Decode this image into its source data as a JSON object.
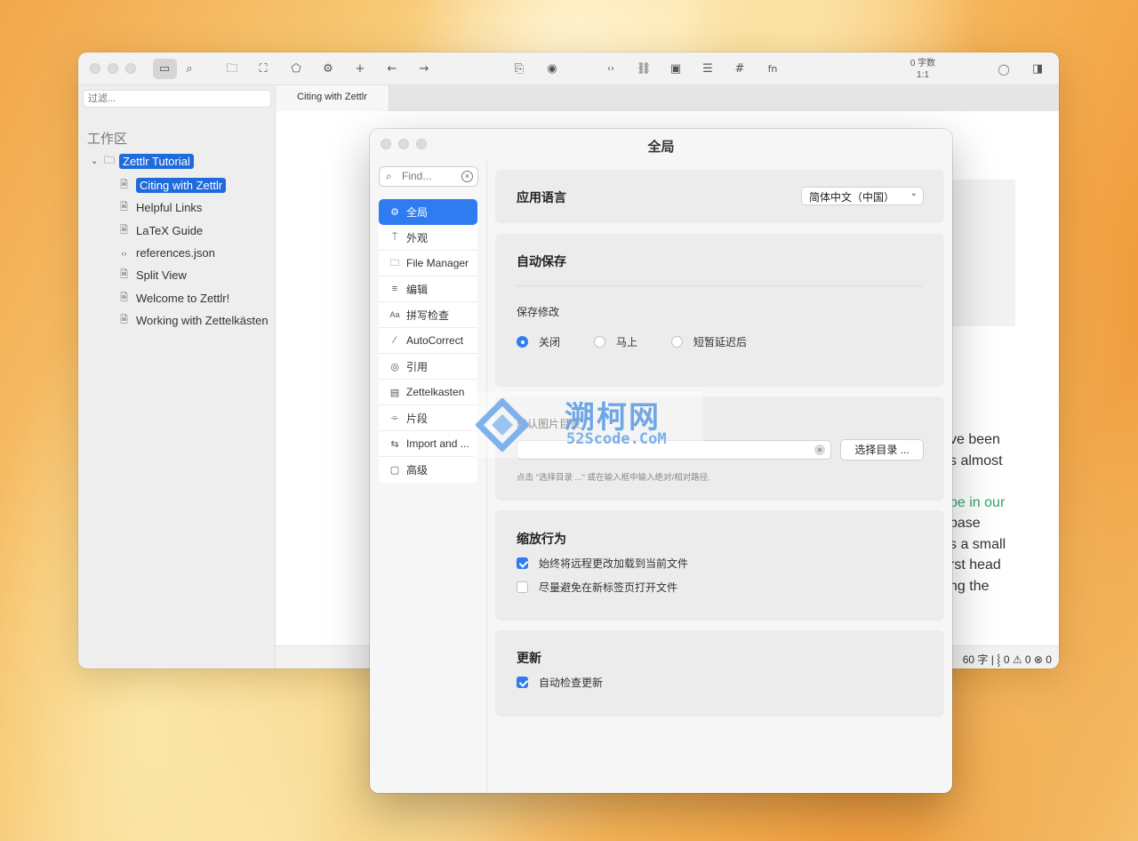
{
  "toolbar": {
    "word_count": "0 字数",
    "cursor_pos": "1:1"
  },
  "sidebar": {
    "filter_placeholder": "过滤...",
    "workspace_title": "工作区",
    "root_folder": "Zettlr Tutorial",
    "files": [
      {
        "name": "Citing with Zettlr",
        "icon": "document-icon",
        "active": true
      },
      {
        "name": "Helpful Links",
        "icon": "document-icon"
      },
      {
        "name": "LaTeX Guide",
        "icon": "document-icon"
      },
      {
        "name": "references.json",
        "icon": "code-icon"
      },
      {
        "name": "Split View",
        "icon": "document-icon"
      },
      {
        "name": "Welcome to Zettlr!",
        "icon": "document-icon"
      },
      {
        "name": "Working with Zettelkästen",
        "icon": "document-icon"
      }
    ]
  },
  "tabs": [
    {
      "label": "Citing with Zettlr"
    }
  ],
  "editor": {
    "lines": [
      "ve been",
      "s almost",
      "",
      "pe in our",
      "base",
      "s a small",
      "rst head",
      "ng the"
    ]
  },
  "statusbar": {
    "text": "60 字 | ⸾ 0 ⚠ 0 ⊗ 0"
  },
  "prefs": {
    "title": "全局",
    "find_placeholder": "Find...",
    "nav": [
      {
        "label": "全局",
        "icon": "gear-icon",
        "active": true
      },
      {
        "label": "外观",
        "icon": "paint-roller-icon"
      },
      {
        "label": "File Manager",
        "icon": "folder-icon"
      },
      {
        "label": "编辑",
        "icon": "text-lines-icon"
      },
      {
        "label": "拼写检查",
        "icon": "spellcheck-icon"
      },
      {
        "label": "AutoCorrect",
        "icon": "magic-wand-icon"
      },
      {
        "label": "引用",
        "icon": "quote-icon"
      },
      {
        "label": "Zettelkasten",
        "icon": "card-icon"
      },
      {
        "label": "片段",
        "icon": "snippet-icon"
      },
      {
        "label": "Import and ...",
        "icon": "import-export-icon"
      },
      {
        "label": "高级",
        "icon": "chip-icon"
      }
    ],
    "language": {
      "heading": "应用语言",
      "value": "简体中文（中国）"
    },
    "autosave": {
      "heading": "自动保存",
      "label": "保存修改",
      "options": [
        "关闭",
        "马上",
        "短暂延迟后"
      ],
      "selected": 0
    },
    "image_dir": {
      "label": "默认图片目录",
      "value": "",
      "button": "选择目录 ...",
      "hint": "点击 \"选择目录 ...\" 或在输入框中输入绝对/相对路径."
    },
    "zoom": {
      "heading": "缩放行为",
      "options": [
        {
          "label": "始终将远程更改加载到当前文件",
          "checked": true
        },
        {
          "label": "尽量避免在新标签页打开文件",
          "checked": false
        }
      ]
    },
    "updates": {
      "heading": "更新",
      "option": {
        "label": "自动检查更新",
        "checked": true
      }
    }
  },
  "watermark": {
    "main": "溯柯网",
    "sub": "52Scode.CoM"
  }
}
